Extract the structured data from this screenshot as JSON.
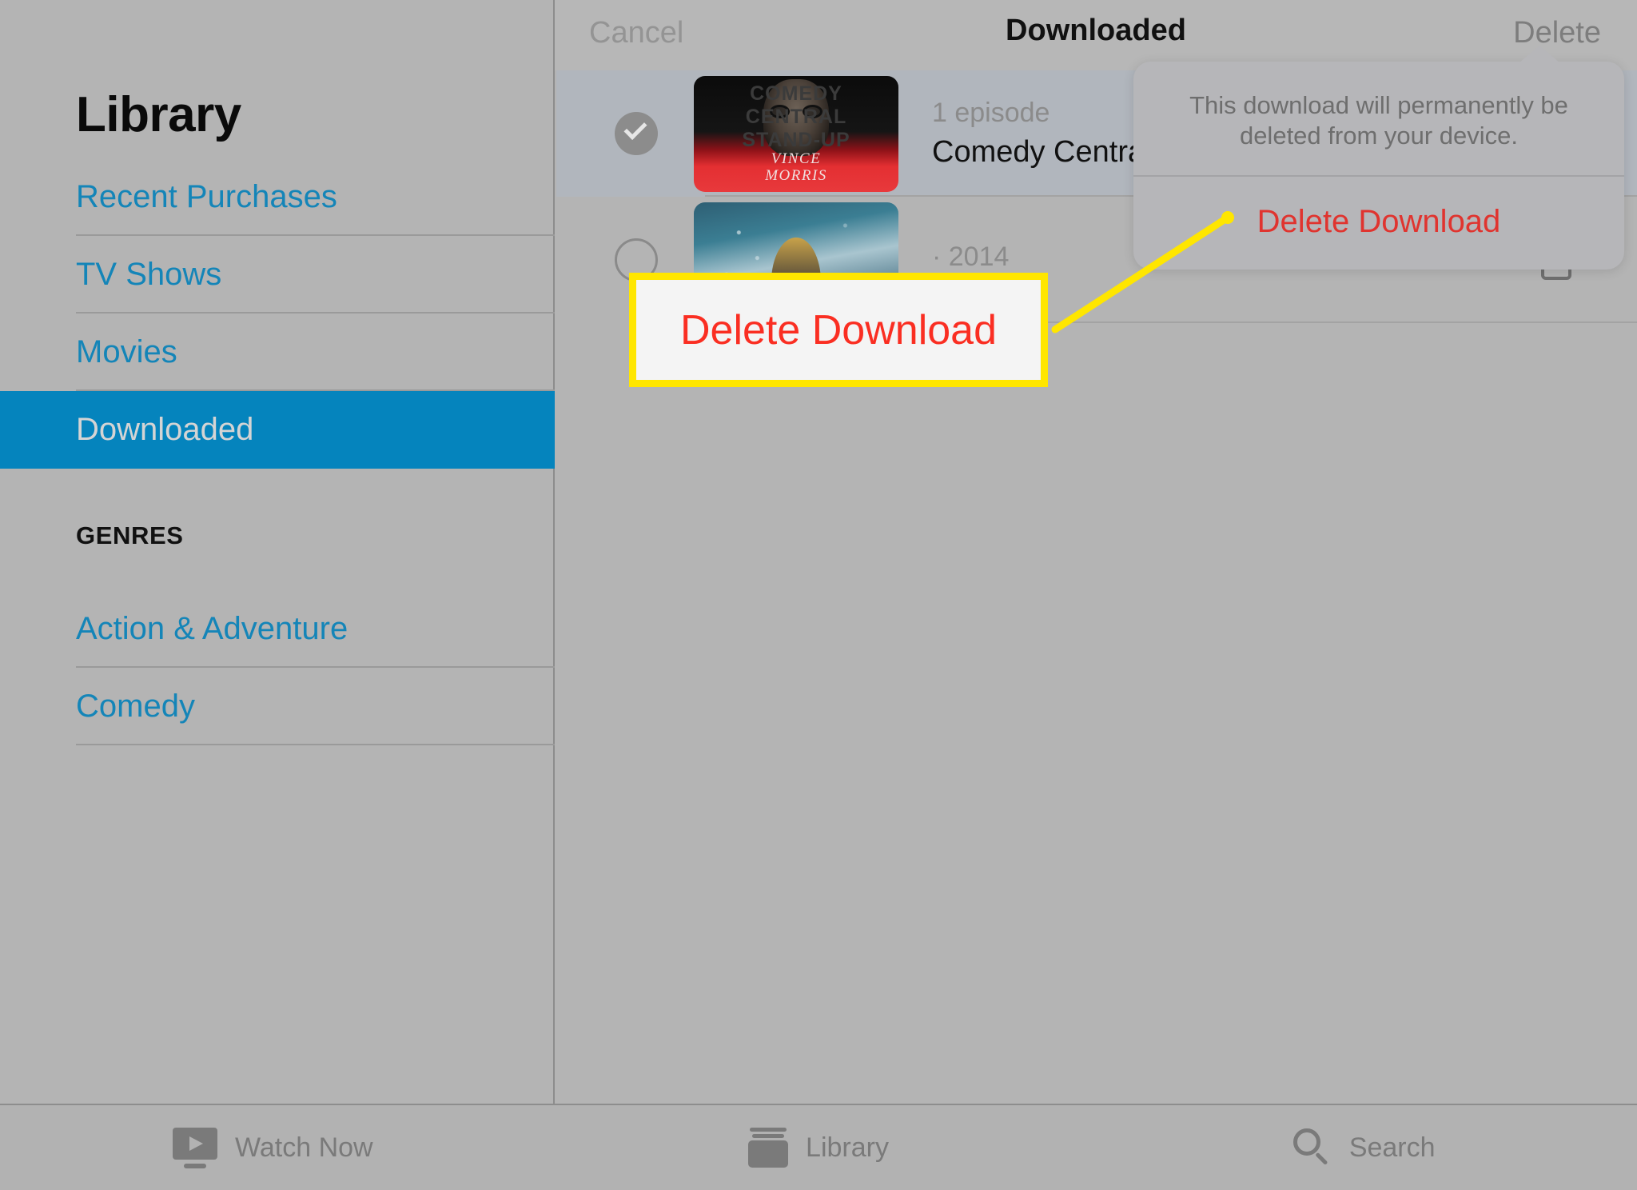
{
  "sidebar": {
    "title": "Library",
    "nav_items": [
      {
        "label": "Recent Purchases",
        "selected": false
      },
      {
        "label": "TV Shows",
        "selected": false
      },
      {
        "label": "Movies",
        "selected": false
      },
      {
        "label": "Downloaded",
        "selected": true
      }
    ],
    "genres_header": "GENRES",
    "genres": [
      {
        "label": "Action & Adventure"
      },
      {
        "label": "Comedy"
      }
    ]
  },
  "topbar": {
    "cancel_label": "Cancel",
    "title": "Downloaded",
    "delete_label": "Delete"
  },
  "list": {
    "rows": [
      {
        "selected": true,
        "subtitle": "1 episode",
        "title": "Comedy Central S",
        "thumb_line1": "COMEDY\nCENTRAL\nSTAND-UP",
        "thumb_name": "VINCE\nMORRIS"
      },
      {
        "selected": false,
        "subtitle": "· 2014",
        "title": "",
        "thumb_line1": "",
        "thumb_name": ""
      }
    ]
  },
  "popover": {
    "message": "This download will permanently be deleted from your device.",
    "action_label": "Delete Download"
  },
  "annotation": {
    "callout_label": "Delete Download",
    "highlight_color": "#ffe600",
    "text_color": "#fa2e22"
  },
  "tabbar": {
    "tabs": [
      {
        "label": "Watch Now",
        "icon": "watch-now-icon"
      },
      {
        "label": "Library",
        "icon": "library-icon"
      },
      {
        "label": "Search",
        "icon": "search-icon"
      }
    ]
  },
  "colors": {
    "accent": "#0584bd",
    "link": "#1485b8",
    "destructive": "#e0342f",
    "background": "#b4b4b4"
  }
}
